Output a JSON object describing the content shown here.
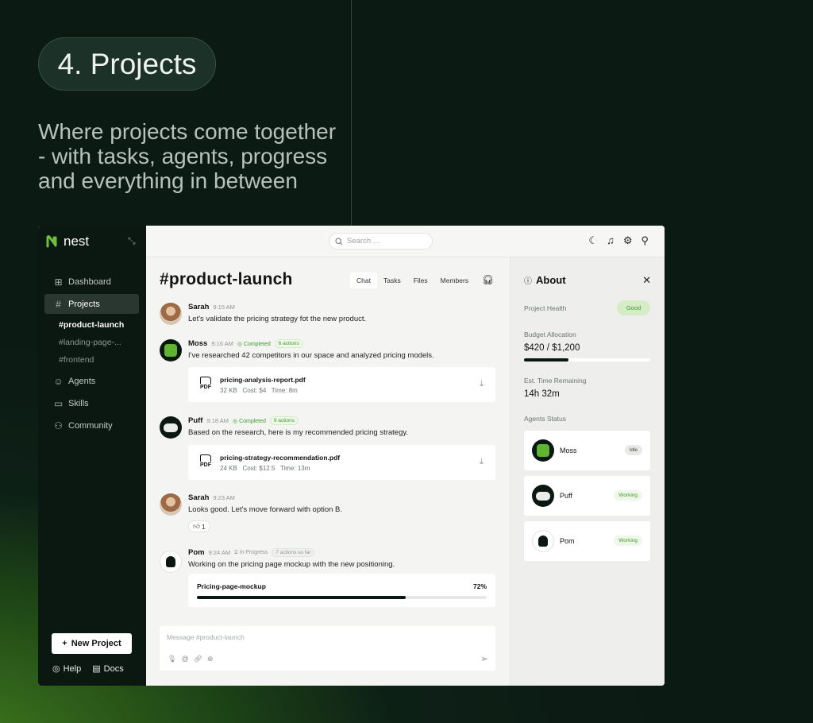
{
  "hero": {
    "pill_title": "4. Projects",
    "headline": "Where projects come together - with tasks, agents, progress and everything in between"
  },
  "sidebar": {
    "logo_text": "nest",
    "items": [
      {
        "label": "Dashboard",
        "icon": "grid-icon"
      },
      {
        "label": "Projects",
        "icon": "hash-icon"
      }
    ],
    "project_channels": [
      "#product-launch",
      "#landing-page-...",
      "#frontend"
    ],
    "items_after": [
      {
        "label": "Agents",
        "icon": "smiley-icon"
      },
      {
        "label": "Skills",
        "icon": "briefcase-icon"
      },
      {
        "label": "Community",
        "icon": "people-icon"
      }
    ],
    "new_project_label": "New Project",
    "help_label": "Help",
    "docs_label": "Docs"
  },
  "topbar": {
    "search_placeholder": "Search ...",
    "icons": [
      "moon-icon",
      "bell-icon",
      "settings-icon",
      "user-icon"
    ]
  },
  "channel": {
    "title": "#product-launch",
    "tabs": [
      "Chat",
      "Tasks",
      "Files",
      "Members"
    ],
    "active_tab": "Chat"
  },
  "messages": [
    {
      "name": "Sarah",
      "time": "9:15 AM",
      "text": "Let's validate the pricing strategy fot the new product."
    },
    {
      "name": "Moss",
      "time": "9:16 AM",
      "status": "Completed",
      "badge": "6 actions",
      "text": "I've researched 42 competitors in our space and analyzed pricing models.",
      "file": {
        "type": "PDF",
        "name": "pricing-analysis-report.pdf",
        "size": "32 KB",
        "cost": "Cost: $4",
        "time": "Time: 8m"
      }
    },
    {
      "name": "Puff",
      "time": "9:18 AM",
      "status": "Completed",
      "badge": "9 actions",
      "text": "Based on the research, here is my recommended pricing strategy.",
      "file": {
        "type": "PDF",
        "name": "pricing-strategy-recommendation.pdf",
        "size": "24 KB",
        "cost": "Cost: $12.5",
        "time": "Time: 13m"
      }
    },
    {
      "name": "Sarah",
      "time": "9:23 AM",
      "text": "Looks good. Let's move forward with option B.",
      "reaction_count": "1"
    },
    {
      "name": "Pom",
      "time": "9:24 AM",
      "status": "In Progress",
      "badge": "7 actions so far",
      "text": "Working on the pricing page mockup with the new positioning.",
      "progress": {
        "label": "Pricing-page-mockup",
        "percent_label": "72%",
        "value": 0.72
      }
    }
  ],
  "composer": {
    "placeholder": "Message #product-launch"
  },
  "about": {
    "title": "About",
    "health_label": "Project Health",
    "health_value": "Good",
    "budget_label": "Budget Allocation",
    "budget_value": "$420 / $1,200",
    "budget_fraction": 0.35,
    "time_label": "Est. Time Remaining",
    "time_value": "14h 32m",
    "agents_label": "Agents Status",
    "agents": [
      {
        "name": "Moss",
        "status": "Idle"
      },
      {
        "name": "Puff",
        "status": "Working"
      },
      {
        "name": "Pom",
        "status": "Working"
      }
    ]
  },
  "colors": {
    "accent_green": "#3e9b2b",
    "dark": "#0b1812",
    "badge_green_bg": "#d5ecc6"
  }
}
